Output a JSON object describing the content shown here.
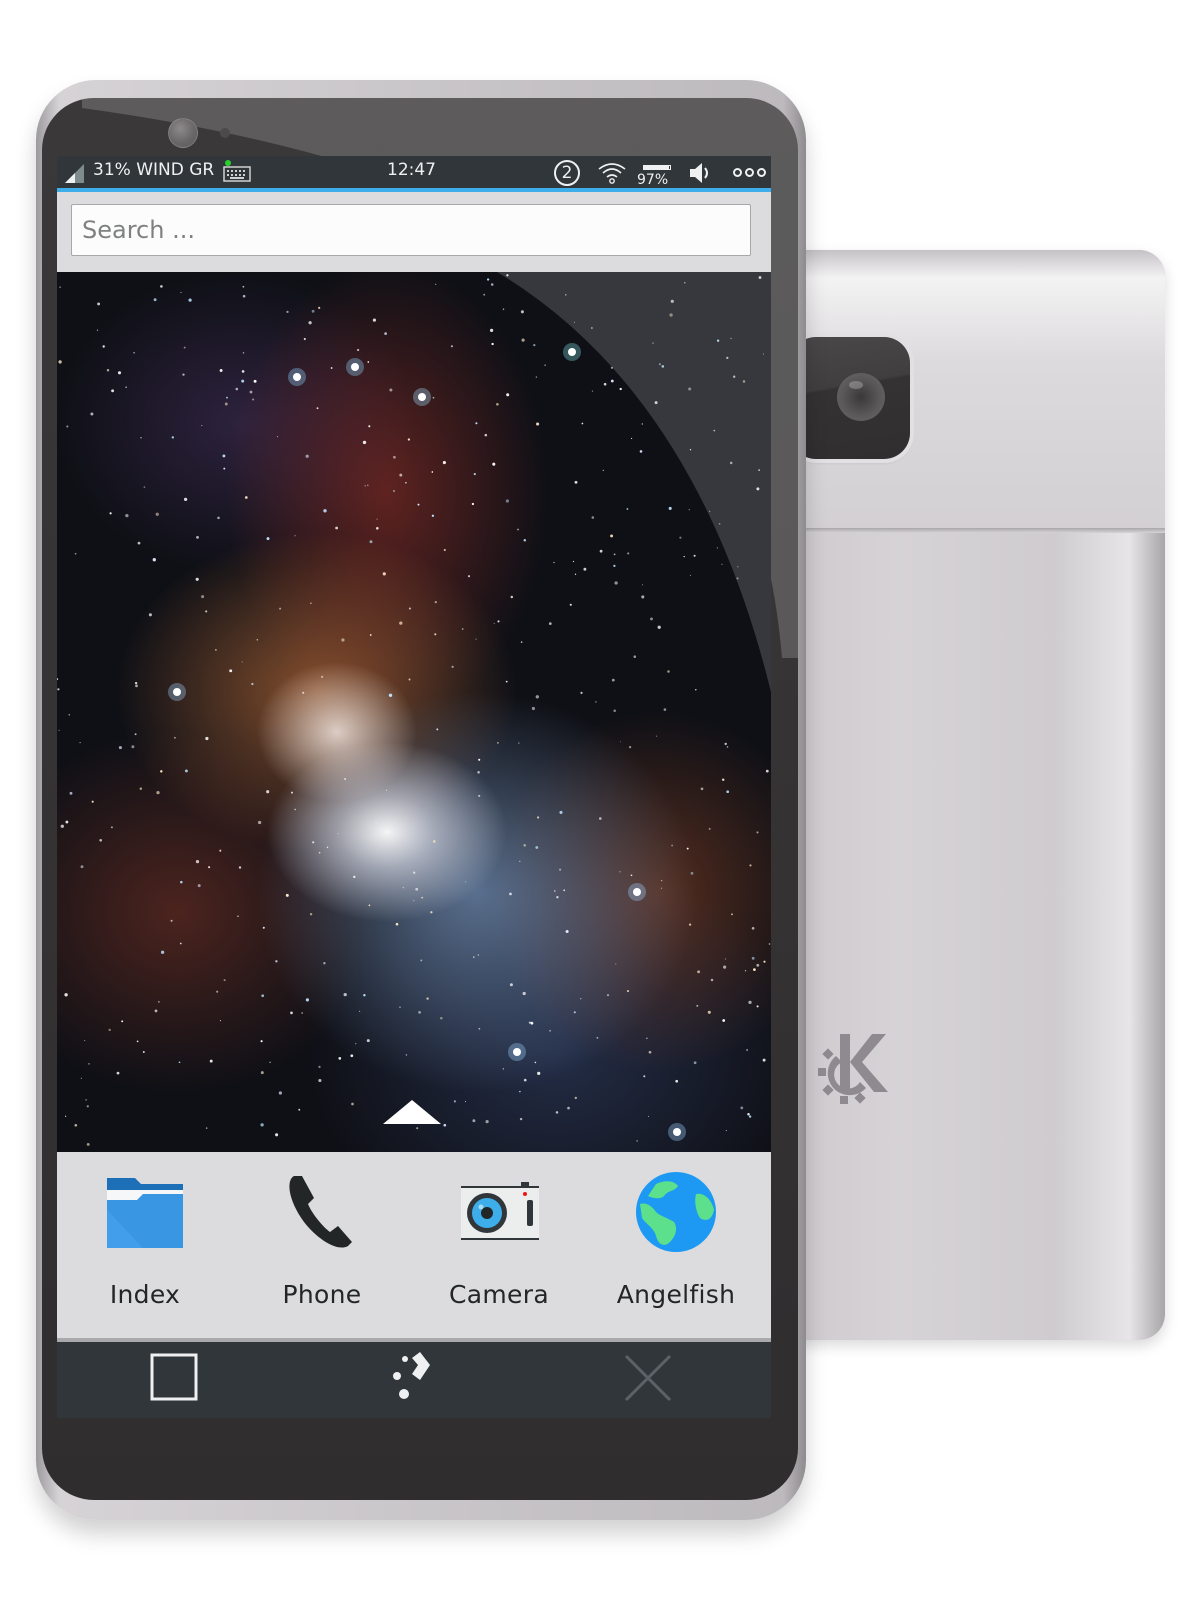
{
  "status_bar": {
    "carrier": "31% WIND GR",
    "time": "12:47",
    "notification_count": "2",
    "battery_percent": 97,
    "battery_label": "97%",
    "icons": [
      "signal-icon",
      "keyboard-icon",
      "notification-badge",
      "wifi-icon",
      "battery-icon",
      "volume-icon",
      "more-icon"
    ],
    "accent_color": "#3daee9"
  },
  "search": {
    "placeholder": "Search ...",
    "value": ""
  },
  "home": {
    "drawer_handle_icon": "chevron-up-icon"
  },
  "dock": {
    "apps": [
      {
        "label": "Index",
        "icon": "folder-icon"
      },
      {
        "label": "Phone",
        "icon": "phone-icon"
      },
      {
        "label": "Camera",
        "icon": "camera-icon"
      },
      {
        "label": "Angelfish",
        "icon": "globe-icon"
      }
    ]
  },
  "navbar": {
    "buttons": [
      {
        "name": "task-switcher",
        "icon": "square-icon"
      },
      {
        "name": "home",
        "icon": "kde-home-icon"
      },
      {
        "name": "close-app",
        "icon": "close-icon",
        "enabled": false
      }
    ]
  },
  "device": {
    "back_logo": "kde-logo"
  }
}
